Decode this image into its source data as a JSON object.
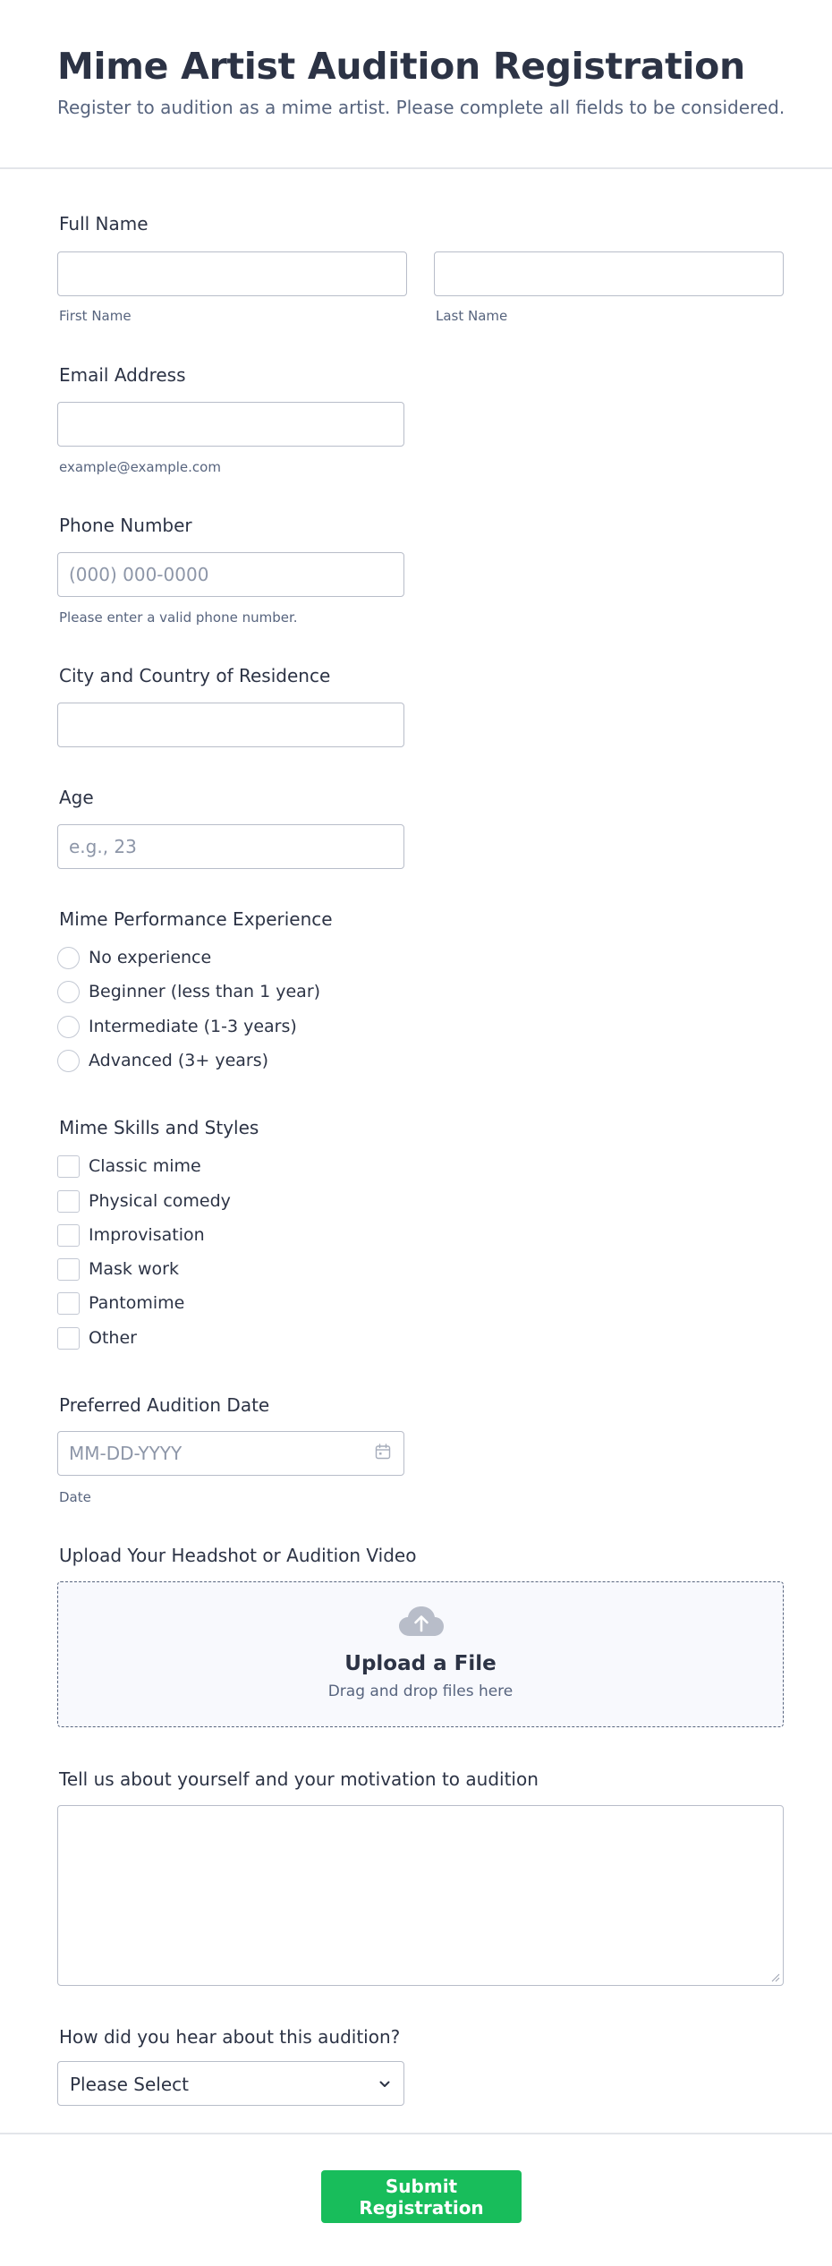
{
  "form": {
    "title": "Mime Artist Audition Registration",
    "subtitle": "Register to audition as a mime artist. Please complete all fields to be considered."
  },
  "full_name": {
    "label": "Full Name",
    "first_sublabel": "First Name",
    "last_sublabel": "Last Name",
    "first_value": "",
    "last_value": ""
  },
  "email": {
    "label": "Email Address",
    "sublabel": "example@example.com",
    "value": ""
  },
  "phone": {
    "label": "Phone Number",
    "placeholder": "(000) 000-0000",
    "sublabel": "Please enter a valid phone number.",
    "value": ""
  },
  "residence": {
    "label": "City and Country of Residence",
    "value": ""
  },
  "age": {
    "label": "Age",
    "placeholder": "e.g., 23",
    "value": ""
  },
  "experience": {
    "label": "Mime Performance Experience",
    "options": [
      "No experience",
      "Beginner (less than 1 year)",
      "Intermediate (1-3 years)",
      "Advanced (3+ years)"
    ]
  },
  "skills": {
    "label": "Mime Skills and Styles",
    "options": [
      "Classic mime",
      "Physical comedy",
      "Improvisation",
      "Mask work",
      "Pantomime",
      "Other"
    ]
  },
  "audition_date": {
    "label": "Preferred Audition Date",
    "placeholder": "MM-DD-YYYY",
    "sublabel": "Date",
    "icon": "calendar-icon"
  },
  "upload": {
    "label": "Upload Your Headshot or Audition Video",
    "title": "Upload a File",
    "hint": "Drag and drop files here",
    "icon": "cloud-upload-icon"
  },
  "motivation": {
    "label": "Tell us about yourself and your motivation to audition",
    "value": ""
  },
  "referral": {
    "label": "How did you hear about this audition?",
    "selected": "Please Select",
    "icon": "chevron-down-icon"
  },
  "submit": {
    "label": "Submit Registration"
  },
  "colors": {
    "accent": "#18bd5b",
    "text": "#2c3345",
    "muted": "#57647e",
    "border": "#b8bdc9"
  }
}
